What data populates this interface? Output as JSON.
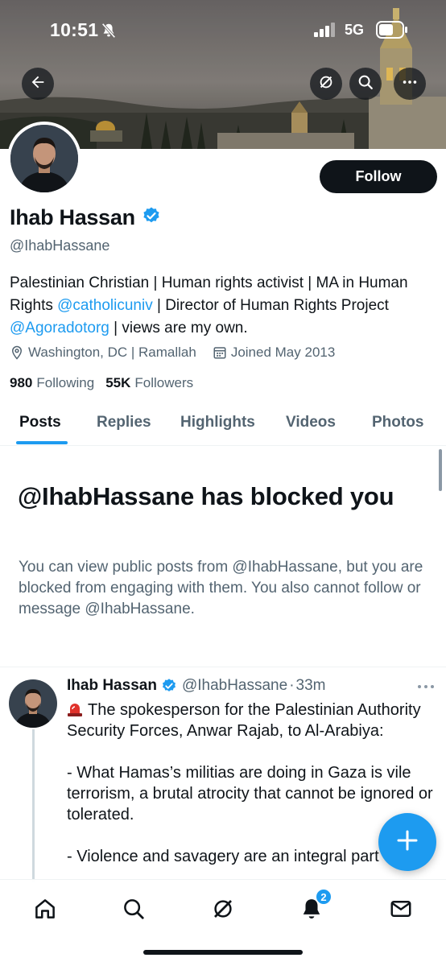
{
  "status_bar": {
    "time": "10:51",
    "network": "5G"
  },
  "header_actions": {
    "back_icon": "arrow-left-icon",
    "grok_icon": "grok-icon",
    "search_icon": "search-icon",
    "more_icon": "more-horizontal-icon"
  },
  "profile": {
    "display_name": "Ihab Hassan",
    "verified": true,
    "handle": "@IhabHassane",
    "follow_label": "Follow",
    "bio": {
      "part1": "Palestinian Christian | Human rights activist | MA in Human Rights ",
      "mention1": "@catholicuniv",
      "part2": " | Director of Human Rights Project ",
      "mention2": "@Agoradotorg",
      "part3": " | views are my own."
    },
    "location": "Washington, DC | Ramallah",
    "joined": "Joined May 2013",
    "following_count": "980",
    "following_label": "Following",
    "followers_count": "55K",
    "followers_label": "Followers"
  },
  "tabs": [
    {
      "label": "Posts",
      "active": true
    },
    {
      "label": "Replies",
      "active": false
    },
    {
      "label": "Highlights",
      "active": false
    },
    {
      "label": "Videos",
      "active": false
    },
    {
      "label": "Photos",
      "active": false
    }
  ],
  "blocked": {
    "title": "@IhabHassane has blocked you",
    "text": "You can view public posts from @IhabHassane, but you are blocked from engaging with them. You also cannot follow or message @IhabHassane."
  },
  "tweet": {
    "author_name": "Ihab Hassan",
    "author_handle": "@IhabHassane",
    "separator": "·",
    "time": "33m",
    "lines": [
      "The spokesperson for the Palestinian Authority Security Forces, Anwar Rajab, to Al-Arabiya:",
      "",
      "- What Hamas’s militias are doing in Gaza is vile terrorism, a brutal atrocity that cannot be ignored or tolerated.",
      "",
      "- Violence and savagery are an integral part of"
    ]
  },
  "compose_icon": "plus-icon",
  "bottom_nav": [
    {
      "name": "home",
      "icon": "home-icon"
    },
    {
      "name": "search",
      "icon": "search-icon"
    },
    {
      "name": "grok",
      "icon": "grok-icon"
    },
    {
      "name": "notifications",
      "icon": "bell-icon",
      "badge": "2"
    },
    {
      "name": "messages",
      "icon": "mail-icon"
    }
  ],
  "colors": {
    "accent": "#1d9bf0",
    "text": "#0f1419",
    "muted": "#536471"
  }
}
